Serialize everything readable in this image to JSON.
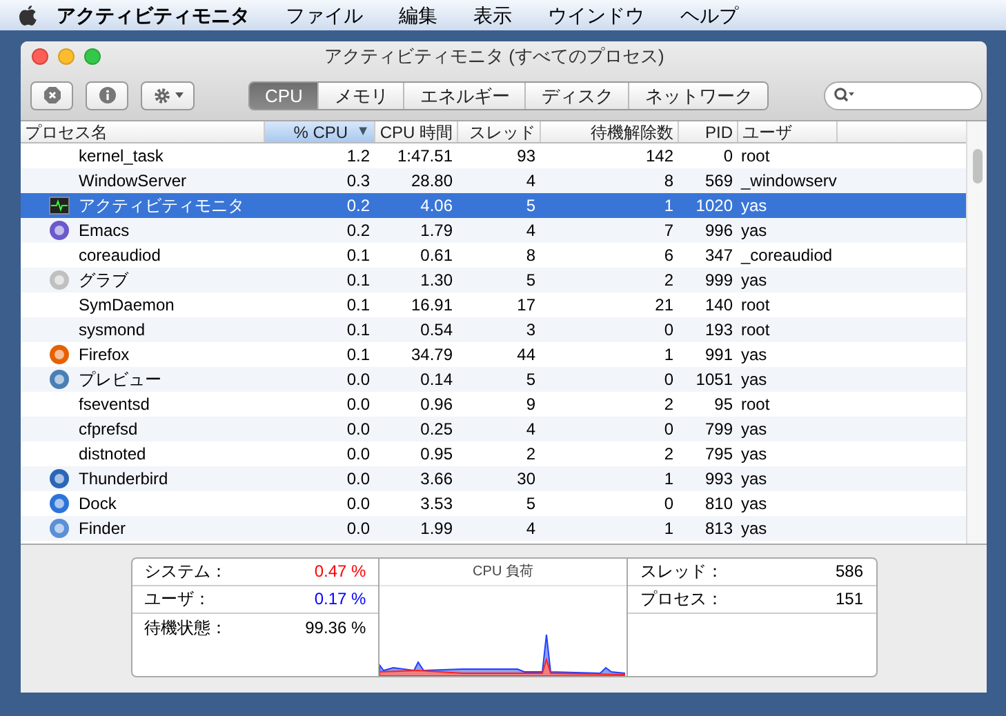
{
  "menu_bar": {
    "app_name": "アクティビティモニタ",
    "menus": [
      "ファイル",
      "編集",
      "表示",
      "ウインドウ",
      "ヘルプ"
    ]
  },
  "window": {
    "title": "アクティビティモニタ (すべてのプロセス)"
  },
  "tabs": [
    {
      "label": "CPU",
      "selected": true
    },
    {
      "label": "メモリ",
      "selected": false
    },
    {
      "label": "エネルギー",
      "selected": false
    },
    {
      "label": "ディスク",
      "selected": false
    },
    {
      "label": "ネットワーク",
      "selected": false
    }
  ],
  "table": {
    "columns": [
      {
        "label": "プロセス名",
        "selected": false
      },
      {
        "label": "% CPU",
        "selected": true,
        "sort_mark": "▼"
      },
      {
        "label": "CPU 時間",
        "selected": false
      },
      {
        "label": "スレッド",
        "selected": false
      },
      {
        "label": "待機解除数",
        "selected": false
      },
      {
        "label": "PID",
        "selected": false
      },
      {
        "label": "ユーザ",
        "selected": false
      }
    ],
    "rows": [
      {
        "kind": "process",
        "name": "kernel_task",
        "cpu": "1.2",
        "time": "1:47.51",
        "threads": "93",
        "wakeups": "142",
        "pid": "0",
        "user": "root",
        "selected": false
      },
      {
        "kind": "process",
        "name": "WindowServer",
        "cpu": "0.3",
        "time": "28.80",
        "threads": "4",
        "wakeups": "8",
        "pid": "569",
        "user": "_windowserv",
        "selected": false
      },
      {
        "kind": "app",
        "name": "アクティビティモニタ",
        "cpu": "0.2",
        "time": "4.06",
        "threads": "5",
        "wakeups": "1",
        "pid": "1020",
        "user": "yas",
        "selected": true
      },
      {
        "kind": "app",
        "name": "Emacs",
        "cpu": "0.2",
        "time": "1.79",
        "threads": "4",
        "wakeups": "7",
        "pid": "996",
        "user": "yas",
        "selected": false
      },
      {
        "kind": "process",
        "name": "coreaudiod",
        "cpu": "0.1",
        "time": "0.61",
        "threads": "8",
        "wakeups": "6",
        "pid": "347",
        "user": "_coreaudiod",
        "selected": false
      },
      {
        "kind": "app",
        "name": "グラブ",
        "cpu": "0.1",
        "time": "1.30",
        "threads": "5",
        "wakeups": "2",
        "pid": "999",
        "user": "yas",
        "selected": false
      },
      {
        "kind": "process",
        "name": "SymDaemon",
        "cpu": "0.1",
        "time": "16.91",
        "threads": "17",
        "wakeups": "21",
        "pid": "140",
        "user": "root",
        "selected": false
      },
      {
        "kind": "process",
        "name": "sysmond",
        "cpu": "0.1",
        "time": "0.54",
        "threads": "3",
        "wakeups": "0",
        "pid": "193",
        "user": "root",
        "selected": false
      },
      {
        "kind": "app",
        "name": "Firefox",
        "cpu": "0.1",
        "time": "34.79",
        "threads": "44",
        "wakeups": "1",
        "pid": "991",
        "user": "yas",
        "selected": false
      },
      {
        "kind": "app",
        "name": "プレビュー",
        "cpu": "0.0",
        "time": "0.14",
        "threads": "5",
        "wakeups": "0",
        "pid": "1051",
        "user": "yas",
        "selected": false
      },
      {
        "kind": "process",
        "name": "fseventsd",
        "cpu": "0.0",
        "time": "0.96",
        "threads": "9",
        "wakeups": "2",
        "pid": "95",
        "user": "root",
        "selected": false
      },
      {
        "kind": "process",
        "name": "cfprefsd",
        "cpu": "0.0",
        "time": "0.25",
        "threads": "4",
        "wakeups": "0",
        "pid": "799",
        "user": "yas",
        "selected": false
      },
      {
        "kind": "process",
        "name": "distnoted",
        "cpu": "0.0",
        "time": "0.95",
        "threads": "2",
        "wakeups": "2",
        "pid": "795",
        "user": "yas",
        "selected": false
      },
      {
        "kind": "app",
        "name": "Thunderbird",
        "cpu": "0.0",
        "time": "3.66",
        "threads": "30",
        "wakeups": "1",
        "pid": "993",
        "user": "yas",
        "selected": false
      },
      {
        "kind": "app",
        "name": "Dock",
        "cpu": "0.0",
        "time": "3.53",
        "threads": "5",
        "wakeups": "0",
        "pid": "810",
        "user": "yas",
        "selected": false
      },
      {
        "kind": "app",
        "name": "Finder",
        "cpu": "0.0",
        "time": "1.99",
        "threads": "4",
        "wakeups": "1",
        "pid": "813",
        "user": "yas",
        "selected": false
      }
    ]
  },
  "summary": {
    "cpu_stats": [
      {
        "label": "システム：",
        "value": "0.47 %",
        "color": "#ff0000"
      },
      {
        "label": "ユーザ：",
        "value": "0.17 %",
        "color": "#0000ff"
      },
      {
        "label": "待機状態：",
        "value": "99.36 %",
        "color": "#000000"
      }
    ],
    "graph_title": "CPU 負荷",
    "counts": [
      {
        "label": "スレッド：",
        "value": "586"
      },
      {
        "label": "プロセス：",
        "value": "151"
      }
    ]
  }
}
